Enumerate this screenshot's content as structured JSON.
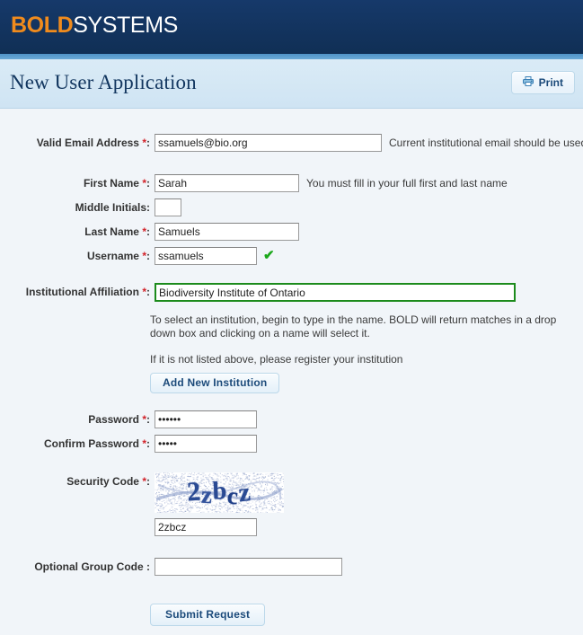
{
  "brand": {
    "bold": "BOLD",
    "systems": "SYSTEMS",
    "bold_color": "#f08b1d",
    "systems_color": "#ffffff",
    "bar_color": "#12365f"
  },
  "header": {
    "title": "New User Application",
    "print_label": "Print",
    "print_icon": "printer-icon",
    "band_color": "#d7e9f5"
  },
  "form": {
    "required_marker": "*",
    "fields": {
      "email": {
        "label": "Valid Email Address",
        "required": true,
        "value": "ssamuels@bio.org",
        "placeholder": "",
        "hint": "Current institutional email should be used"
      },
      "first_name": {
        "label": "First Name",
        "required": true,
        "value": "Sarah",
        "placeholder": "",
        "hint": "You must fill in your full first and last name"
      },
      "middle_initials": {
        "label": "Middle Initials",
        "required": false,
        "value": "",
        "placeholder": "",
        "hint": ""
      },
      "last_name": {
        "label": "Last Name",
        "required": true,
        "value": "Samuels",
        "placeholder": "",
        "hint": ""
      },
      "username": {
        "label": "Username",
        "required": true,
        "value": "ssamuels",
        "placeholder": "",
        "status_icon": "green-check-icon",
        "status_glyph": "✔",
        "status_color": "#1ba81b"
      },
      "institution": {
        "label": "Institutional Affiliation",
        "required": true,
        "value": "Biodiversity Institute of Ontario",
        "placeholder": "",
        "valid_border_color": "#1c8b1c"
      },
      "password": {
        "label": "Password",
        "required": true,
        "value": "••••••",
        "placeholder": ""
      },
      "confirm_password": {
        "label": "Confirm Password",
        "required": true,
        "value": "•••••",
        "placeholder": ""
      },
      "security_code": {
        "label": "Security Code",
        "required": true,
        "captcha_text": "2zbcz",
        "value": "2zbcz",
        "placeholder": ""
      },
      "group_code": {
        "label": "Optional Group Code ",
        "required": false,
        "value": "",
        "placeholder": ""
      }
    },
    "institution_help": {
      "line1": "To select an institution, begin to type in the name. BOLD will return matches in a drop down box and clicking on a name will select it.",
      "line2": "If it is not listed above, please register your institution",
      "add_button": "Add New Institution"
    },
    "submit_label": "Submit Request"
  }
}
